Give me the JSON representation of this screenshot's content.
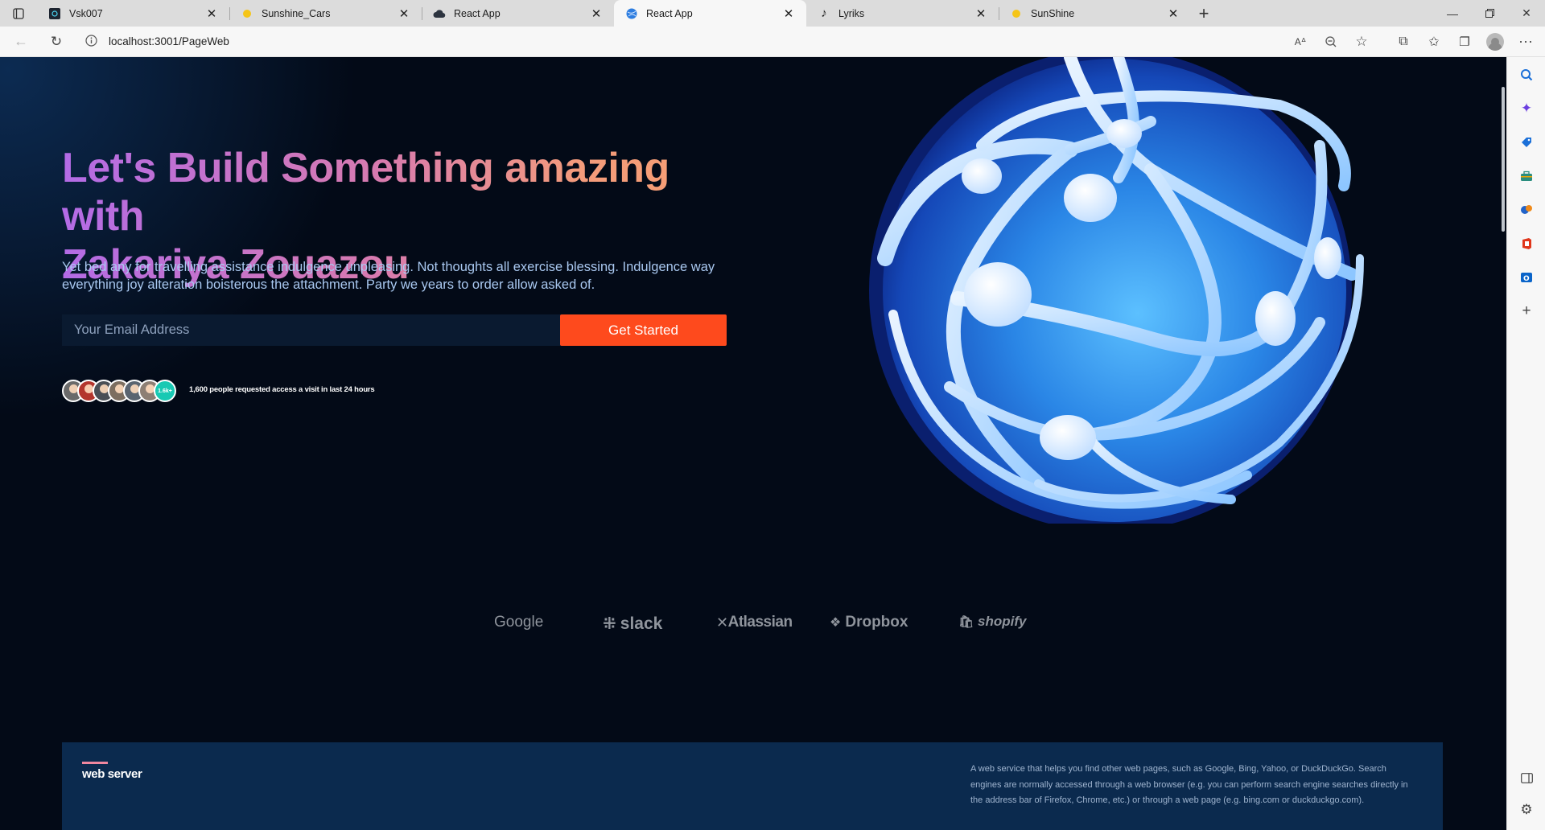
{
  "browser": {
    "tabs": [
      {
        "title": "Vsk007",
        "icon": "grid-app-icon",
        "active": false
      },
      {
        "title": "Sunshine_Cars",
        "icon": "sun-dot-icon",
        "active": false
      },
      {
        "title": "React App",
        "icon": "cloud-icon",
        "active": false
      },
      {
        "title": "React App",
        "icon": "globe-favicon-icon",
        "active": true
      },
      {
        "title": "Lyriks",
        "icon": "music-note-icon",
        "active": false
      },
      {
        "title": "SunShine",
        "icon": "sun-dot-icon",
        "active": false
      }
    ],
    "url": "localhost:3001/PageWeb"
  },
  "hero": {
    "title_line1": "Let's Build Something amazing with",
    "title_line2": "Zakariya Zouazou",
    "subtitle": "Yet bed any for travelling assistance indulgence unpleasing. Not thoughts all exercise blessing. Indulgence way everything joy alteration boisterous the attachment. Party we years to order allow asked of.",
    "email_placeholder": "Your Email Address",
    "cta_label": "Get Started",
    "avatar_badge": "1.6k+",
    "social_proof": "1,600 people requested access a visit in last 24 hours"
  },
  "brands": [
    "Google",
    "slack",
    "Atlassian",
    "Dropbox",
    "shopify"
  ],
  "footer": {
    "brand": "web server",
    "description": "A web service that helps you find other web pages, such as Google, Bing, Yahoo, or DuckDuckGo. Search engines are normally accessed through a web browser (e.g. you can perform search engine searches directly in the address bar of Firefox, Chrome, etc.) or through a web page (e.g. bing.com or duckduckgo.com)."
  },
  "colors": {
    "page_bg": "#030a17",
    "cta": "#fe4a1d",
    "footer_bg": "#0b2a4e",
    "title_gradient_start": "#b36be6",
    "title_gradient_end": "#f8a070"
  }
}
